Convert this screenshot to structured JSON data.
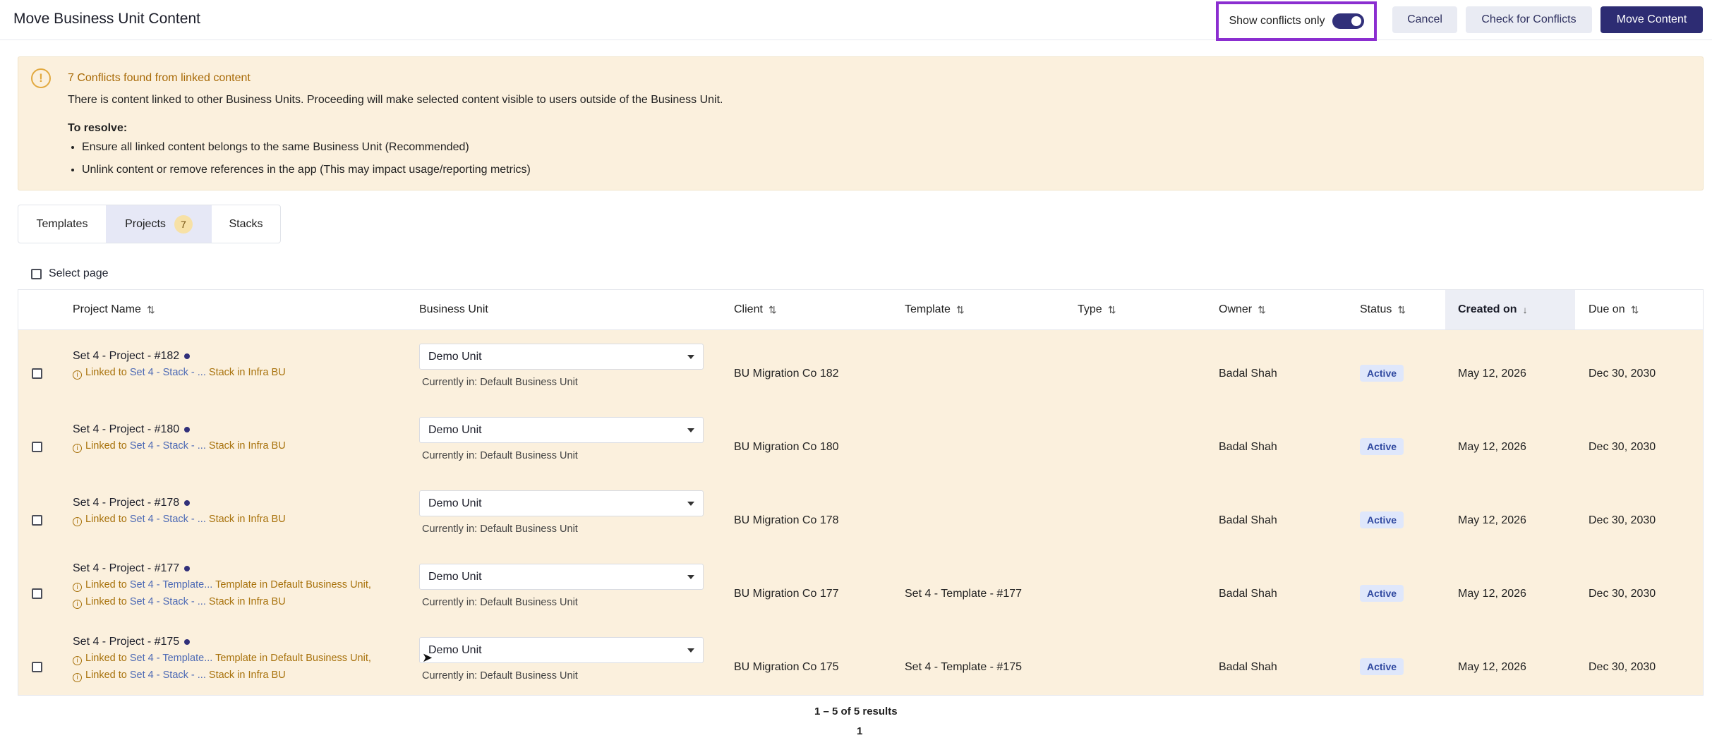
{
  "header": {
    "title": "Move Business Unit Content",
    "toggle_label": "Show conflicts only",
    "toggle_on": true,
    "cancel_label": "Cancel",
    "check_label": "Check for Conflicts",
    "move_label": "Move Content"
  },
  "alert": {
    "title": "7 Conflicts found from linked content",
    "body": "There is content linked to other Business Units. Proceeding will make selected content visible to users outside of the Business Unit.",
    "resolve_heading": "To resolve:",
    "bullets": [
      "Ensure all linked content belongs to the same Business Unit (Recommended)",
      "Unlink content or remove references in the app (This may impact usage/reporting metrics)"
    ]
  },
  "tabs": [
    {
      "label": "Templates"
    },
    {
      "label": "Projects",
      "badge": "7"
    },
    {
      "label": "Stacks"
    }
  ],
  "select_page_label": "Select page",
  "table": {
    "headers": {
      "project_name": "Project Name",
      "business_unit": "Business Unit",
      "client": "Client",
      "template": "Template",
      "type": "Type",
      "owner": "Owner",
      "status": "Status",
      "created_on": "Created on",
      "due_on": "Due on"
    },
    "currently_prefix": "Currently in: Default Business Unit",
    "rows": [
      {
        "name": "Set 4 - Project - #182",
        "links": [
          {
            "prefix": "Linked to ",
            "target": "Set 4 - Stack - ...",
            "suffix": " Stack in Infra BU"
          }
        ],
        "business_unit": "Demo Unit",
        "currently": "Currently in: Default Business Unit",
        "client": "BU Migration Co 182",
        "template": "",
        "type": "",
        "owner": "Badal Shah",
        "status": "Active",
        "created_on": "May 12, 2026",
        "due_on": "Dec 30, 2030"
      },
      {
        "name": "Set 4 - Project - #180",
        "links": [
          {
            "prefix": "Linked to ",
            "target": "Set 4 - Stack - ...",
            "suffix": " Stack in Infra BU"
          }
        ],
        "business_unit": "Demo Unit",
        "currently": "Currently in: Default Business Unit",
        "client": "BU Migration Co 180",
        "template": "",
        "type": "",
        "owner": "Badal Shah",
        "status": "Active",
        "created_on": "May 12, 2026",
        "due_on": "Dec 30, 2030"
      },
      {
        "name": "Set 4 - Project - #178",
        "links": [
          {
            "prefix": "Linked to ",
            "target": "Set 4 - Stack - ...",
            "suffix": " Stack in Infra BU"
          }
        ],
        "business_unit": "Demo Unit",
        "currently": "Currently in: Default Business Unit",
        "client": "BU Migration Co 178",
        "template": "",
        "type": "",
        "owner": "Badal Shah",
        "status": "Active",
        "created_on": "May 12, 2026",
        "due_on": "Dec 30, 2030"
      },
      {
        "name": "Set 4 - Project - #177",
        "links": [
          {
            "prefix": "Linked to ",
            "target": "Set 4 - Template...",
            "suffix": " Template in Default Business Unit,"
          },
          {
            "prefix": "Linked to ",
            "target": "Set 4 - Stack - ...",
            "suffix": " Stack in Infra BU"
          }
        ],
        "business_unit": "Demo Unit",
        "currently": "Currently in: Default Business Unit",
        "client": "BU Migration Co 177",
        "template": "Set 4 - Template - #177",
        "type": "",
        "owner": "Badal Shah",
        "status": "Active",
        "created_on": "May 12, 2026",
        "due_on": "Dec 30, 2030"
      },
      {
        "name": "Set 4 - Project - #175",
        "links": [
          {
            "prefix": "Linked to ",
            "target": "Set 4 - Template...",
            "suffix": " Template in Default Business Unit,"
          },
          {
            "prefix": "Linked to ",
            "target": "Set 4 - Stack - ...",
            "suffix": " Stack in Infra BU"
          }
        ],
        "business_unit": "Demo Unit",
        "currently": "Currently in: Default Business Unit",
        "client": "BU Migration Co 175",
        "template": "Set 4 - Template - #175",
        "type": "",
        "owner": "Badal Shah",
        "status": "Active",
        "created_on": "May 12, 2026",
        "due_on": "Dec 30, 2030"
      }
    ]
  },
  "pagination": {
    "summary": "1 – 5 of 5 results",
    "current_page": "1"
  },
  "icons": {
    "warning": "warning-icon",
    "info": "info-icon",
    "sort": "sort-icon",
    "sort_down": "arrow-down-icon",
    "dropdown": "chevron-down-icon"
  },
  "colors": {
    "primary": "#2d2c73",
    "alert_bg": "#fbf0dd",
    "warning": "#a86a07",
    "highlight_border": "#8b2ed0"
  }
}
